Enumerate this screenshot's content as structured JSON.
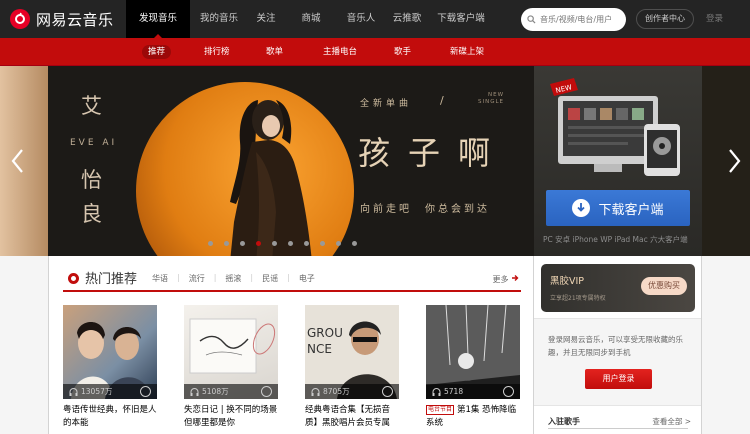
{
  "brand": {
    "name": "网易云音乐"
  },
  "topnav": {
    "items": [
      "发现音乐",
      "我的音乐",
      "关注",
      "商城",
      "音乐人",
      "云推歌",
      "下载客户端"
    ],
    "active": 0
  },
  "search": {
    "placeholder": "音乐/视频/电台/用户"
  },
  "creator_center": "创作者中心",
  "login": "登录",
  "subnav": {
    "items": [
      "推荐",
      "排行榜",
      "歌单",
      "主播电台",
      "歌手",
      "新碟上架"
    ],
    "active": 0
  },
  "banner": {
    "artist_cn_1": "艾",
    "artist_cn_2": "怡",
    "artist_cn_3": "良",
    "artist_en": "EVE AI",
    "new_single": "全新单曲",
    "slash": "/",
    "new_single_en": "NEW\nSINGLE",
    "song_title": "孩子啊",
    "tagline": "向前走吧　你总会到达",
    "dot_count": 10,
    "active_dot": 3
  },
  "download": {
    "badge": "NEW",
    "button_label": "下载客户端",
    "platforms": "PC 安卓 iPhone WP iPad Mac 六大客户端"
  },
  "hot": {
    "title": "热门推荐",
    "tags": [
      "华语",
      "流行",
      "摇滚",
      "民谣",
      "电子"
    ],
    "more": "更多"
  },
  "playlists": [
    {
      "plays": "13057万",
      "title": "粤语传世经典，怀旧是人的本能",
      "badge": ""
    },
    {
      "plays": "5108万",
      "title": "失恋日记 | 换不同的场景 但哪里都是你",
      "badge": ""
    },
    {
      "plays": "8705万",
      "title": "经典粤语合集【无损音质】黑胶唱片会员专属",
      "badge": ""
    },
    {
      "plays": "5718",
      "title": "第1集 恐怖降临系统",
      "badge": "电台节目"
    }
  ],
  "vip": {
    "title": "黑胶VIP",
    "subtitle": "立享超21项专属特权",
    "buy": "优惠购买"
  },
  "sidebar": {
    "info": "登录网易云音乐，可以享受无限收藏的乐趣，并且无限同步到手机",
    "login_button": "用户登录",
    "singers_title": "入驻歌手",
    "singers_all": "查看全部 >"
  },
  "colors": {
    "brand_red": "#c20c0c",
    "topbar": "#242424",
    "download_blue": "#2f6fd0"
  }
}
